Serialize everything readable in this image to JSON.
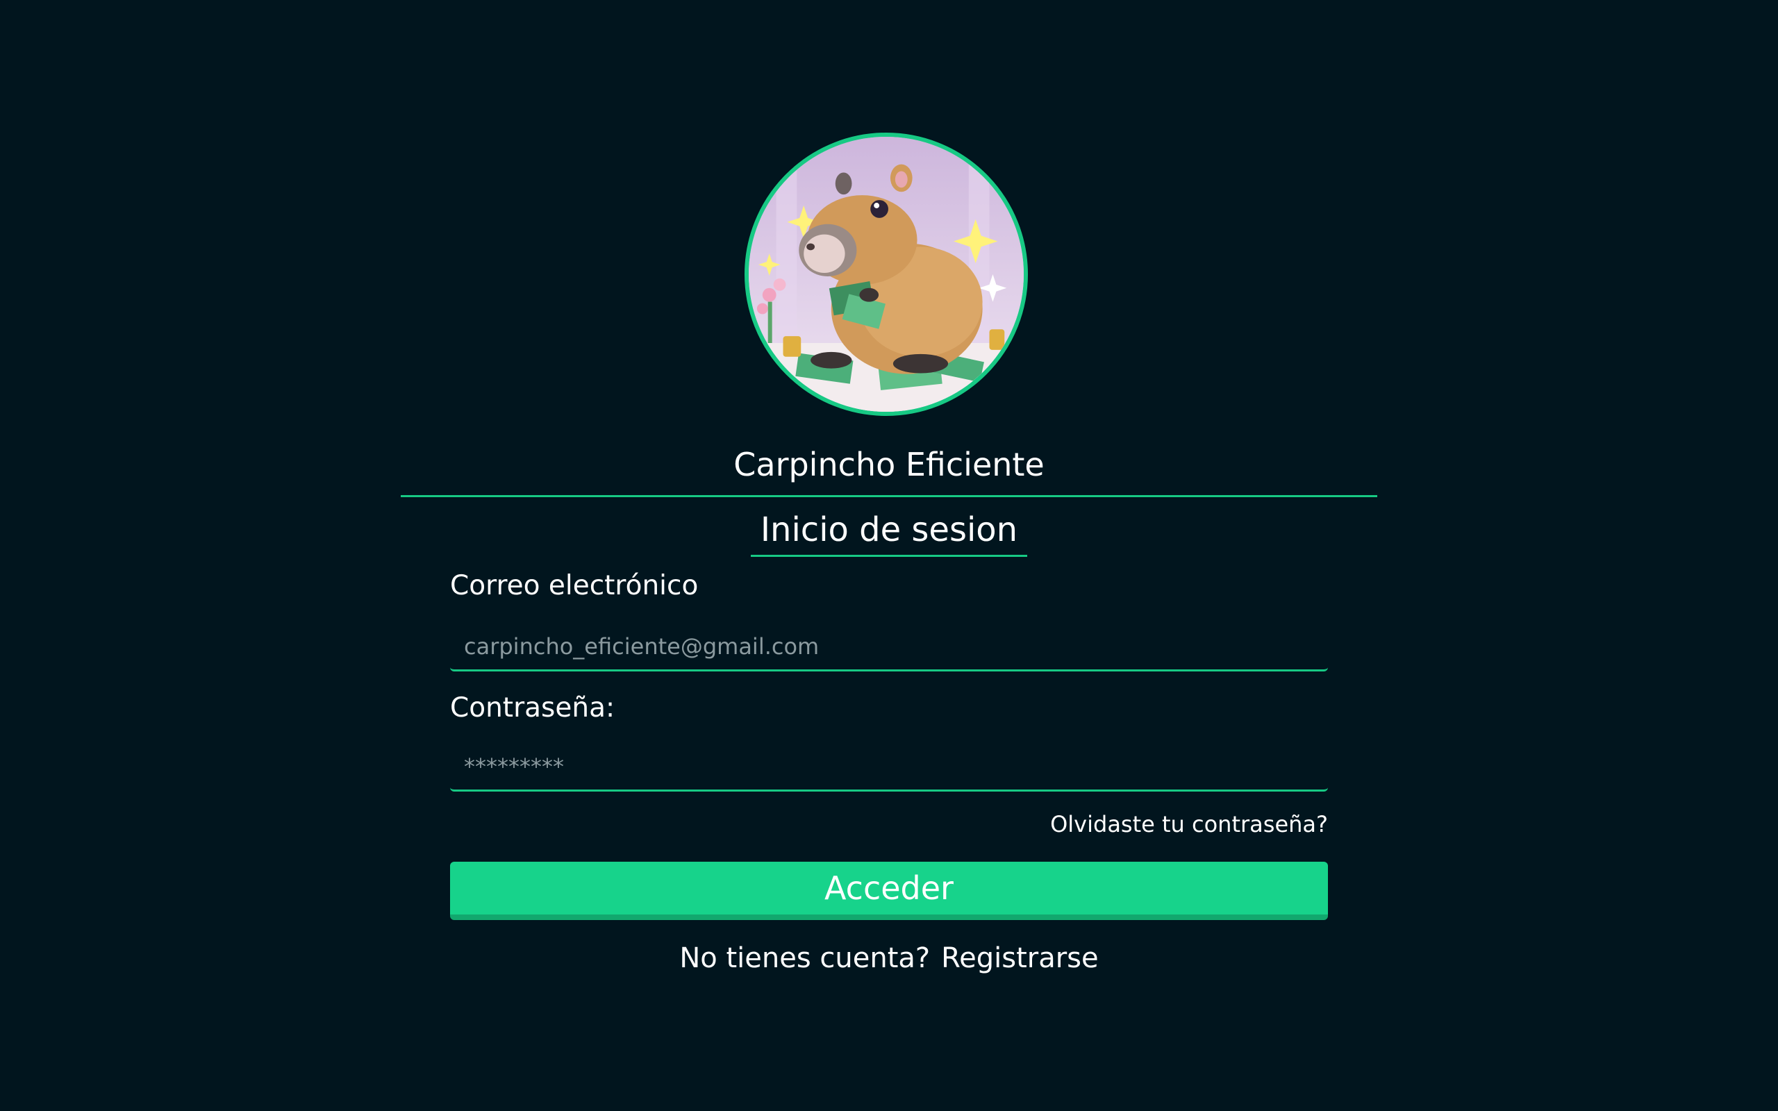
{
  "app": {
    "title": "Carpincho Eficiente"
  },
  "avatar": {
    "icon": "capybara-with-money-illustration"
  },
  "login": {
    "heading": "Inicio de sesion",
    "email_label": "Correo electrónico",
    "email_placeholder": "carpincho_eficiente@gmail.com",
    "password_label": "Contraseña:",
    "password_placeholder": "*********",
    "forgot_link": "Olvidaste tu contraseña?",
    "submit_label": "Acceder",
    "no_account_text": "No tienes cuenta?",
    "register_link": "Registrarse"
  },
  "colors": {
    "background": "#01151e",
    "accent": "#17c984",
    "button": "#17d38b",
    "text": "#ffffff"
  }
}
